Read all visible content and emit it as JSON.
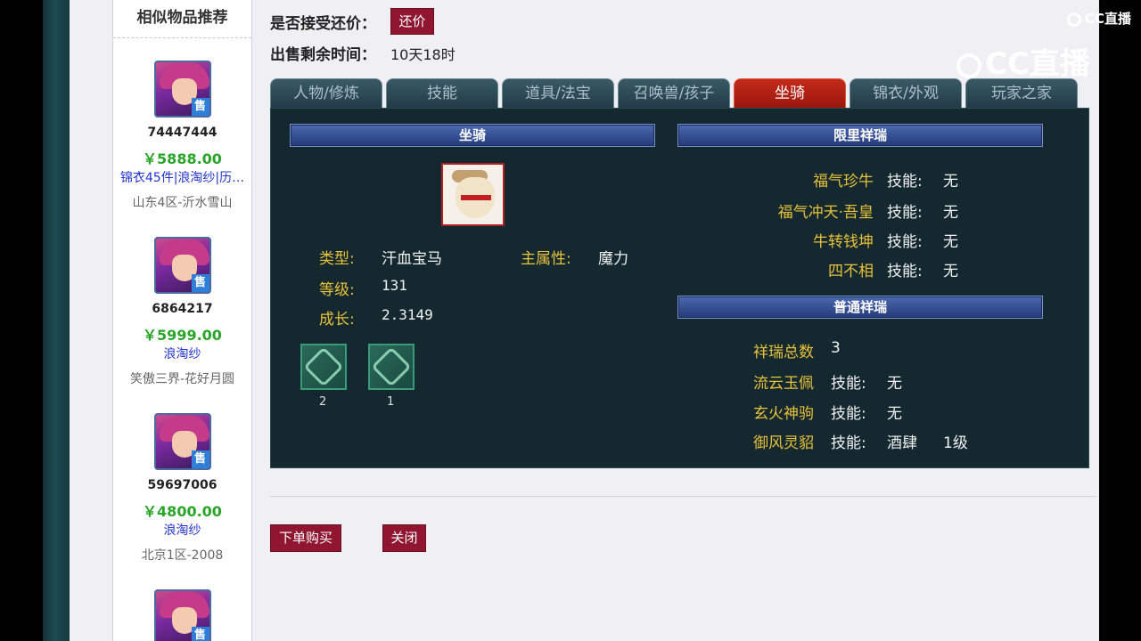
{
  "sidebar": {
    "title": "相似物品推荐",
    "items": [
      {
        "id": "74447444",
        "price": "￥5888.00",
        "tags": "锦衣45件|浪淘纱|历…",
        "server": "山东4区-沂水雪山",
        "badge": "售"
      },
      {
        "id": "6864217",
        "price": "￥5999.00",
        "tags": "浪淘纱",
        "server": "笑傲三界-花好月圆",
        "badge": "售"
      },
      {
        "id": "59697006",
        "price": "￥4800.00",
        "tags": "浪淘纱",
        "server": "北京1区-2008",
        "badge": "售"
      },
      {
        "id": "",
        "price": "",
        "tags": "",
        "server": "",
        "badge": "售"
      }
    ]
  },
  "header": {
    "counter_offer_label": "是否接受还价：",
    "counter_offer_button": "还价",
    "time_left_label": "出售剩余时间：",
    "time_left_value": "10天18时"
  },
  "tabs": [
    "人物/修炼",
    "技能",
    "道具/法宝",
    "召唤兽/孩子",
    "坐骑",
    "锦衣/外观",
    "玩家之家"
  ],
  "active_tab": "坐骑",
  "mount": {
    "section_title": "坐骑",
    "type_label": "类型:",
    "type_value": "汗血宝马",
    "main_attr_label": "主属性:",
    "main_attr_value": "魔力",
    "level_label": "等级:",
    "level_value": "131",
    "growth_label": "成长:",
    "growth_value": "2.3149",
    "skills": [
      {
        "num": "2",
        "icon": "mount-skill-icon"
      },
      {
        "num": "1",
        "icon": "mount-skill-icon"
      }
    ]
  },
  "limited": {
    "section_title": "限里祥瑞",
    "items": [
      {
        "name": "福气珍牛",
        "skill_label": "技能:",
        "skill_value": "无"
      },
      {
        "name": "福气冲天·吾皇",
        "skill_label": "技能:",
        "skill_value": "无"
      },
      {
        "name": "牛转钱坤",
        "skill_label": "技能:",
        "skill_value": "无"
      },
      {
        "name": "四不相",
        "skill_label": "技能:",
        "skill_value": "无"
      }
    ]
  },
  "normal": {
    "section_title": "普通祥瑞",
    "total_label": "祥瑞总数",
    "total_value": "3",
    "items": [
      {
        "name": "流云玉佩",
        "skill_label": "技能:",
        "skill_value": "无",
        "level": ""
      },
      {
        "name": "玄火神驹",
        "skill_label": "技能:",
        "skill_value": "无",
        "level": ""
      },
      {
        "name": "御风灵貂",
        "skill_label": "技能:",
        "skill_value": "酒肆",
        "level": "1级"
      }
    ]
  },
  "actions": {
    "buy": "下单购买",
    "close": "关闭"
  },
  "watermark": {
    "small": "CC直播",
    "big": "CC直播"
  }
}
